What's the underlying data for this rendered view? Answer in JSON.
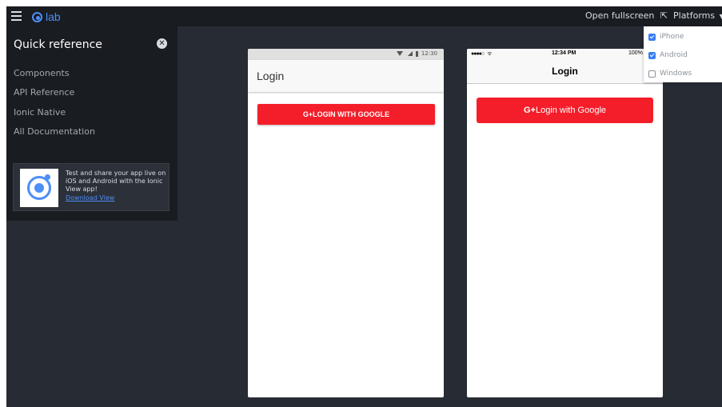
{
  "topbar": {
    "logo_text": "lab",
    "open_fullscreen": "Open fullscreen",
    "platforms": "Platforms"
  },
  "platform_menu": {
    "options": [
      {
        "label": "iPhone",
        "checked": true
      },
      {
        "label": "Android",
        "checked": true
      },
      {
        "label": "Windows",
        "checked": false
      }
    ]
  },
  "sidebar": {
    "title": "Quick reference",
    "links": [
      "Components",
      "API Reference",
      "Ionic Native",
      "All Documentation"
    ],
    "promo": {
      "text": "Test and share your app live on iOS and Android with the Ionic View app!",
      "link": "Download View"
    }
  },
  "android": {
    "status_time": "12:30",
    "title": "Login",
    "button_g": "G+",
    "button_label": "LOGIN WITH GOOGLE"
  },
  "ios": {
    "status_dots": "●●●●○",
    "status_time": "12:34 PM",
    "status_battery": "100%",
    "title": "Login",
    "button_g": "G+",
    "button_label": "Login with Google"
  },
  "colors": {
    "accent": "#4e8ef7",
    "button_red": "#f41e2a",
    "dark_bg": "#272b33",
    "sidebar_bg": "#191c21"
  }
}
